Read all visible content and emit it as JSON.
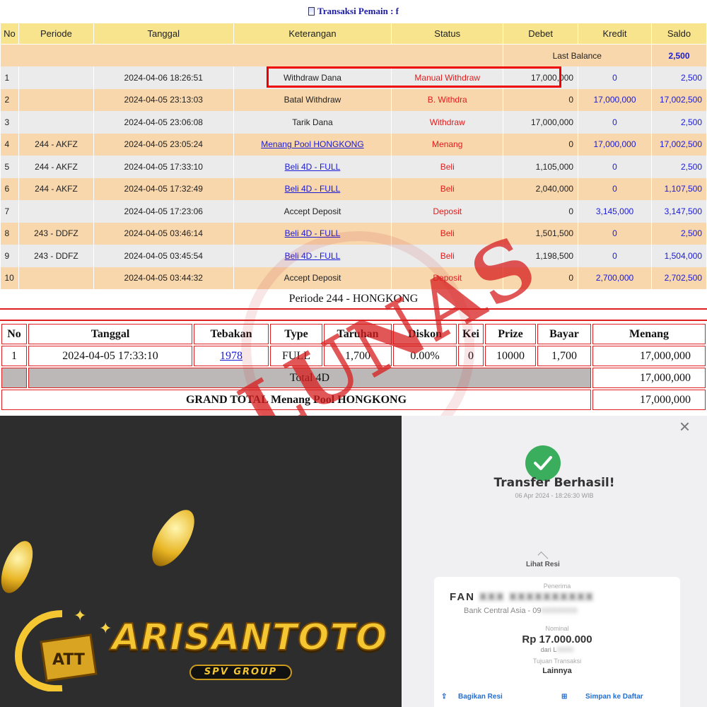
{
  "header": {
    "title": "Transaksi Pemain : f"
  },
  "tx_table": {
    "columns": [
      "No",
      "Periode",
      "Tanggal",
      "Keterangan",
      "Status",
      "Debet",
      "Kredit",
      "Saldo"
    ],
    "last_balance_label": "Last Balance",
    "last_balance_value": "2,500",
    "rows": [
      {
        "no": "1",
        "periode": "",
        "tanggal": "2024-04-06 18:26:51",
        "keterangan": "Withdraw Dana",
        "link": false,
        "status": "Manual Withdraw",
        "debet": "17,000,000",
        "kredit": "0",
        "saldo": "2,500"
      },
      {
        "no": "2",
        "periode": "",
        "tanggal": "2024-04-05 23:13:03",
        "keterangan": "Batal Withdraw",
        "link": false,
        "status": "B. Withdra",
        "debet": "0",
        "kredit": "17,000,000",
        "saldo": "17,002,500"
      },
      {
        "no": "3",
        "periode": "",
        "tanggal": "2024-04-05 23:06:08",
        "keterangan": "Tarik Dana",
        "link": false,
        "status": "Withdraw",
        "debet": "17,000,000",
        "kredit": "0",
        "saldo": "2,500"
      },
      {
        "no": "4",
        "periode": "244 - AKFZ",
        "tanggal": "2024-04-05 23:05:24",
        "keterangan": "Menang Pool HONGKONG",
        "link": true,
        "status": "Menang",
        "debet": "0",
        "kredit": "17,000,000",
        "saldo": "17,002,500"
      },
      {
        "no": "5",
        "periode": "244 - AKFZ",
        "tanggal": "2024-04-05 17:33:10",
        "keterangan": "Beli 4D - FULL",
        "link": true,
        "status": "Beli",
        "debet": "1,105,000",
        "kredit": "0",
        "saldo": "2,500"
      },
      {
        "no": "6",
        "periode": "244 - AKFZ",
        "tanggal": "2024-04-05 17:32:49",
        "keterangan": "Beli 4D - FULL",
        "link": true,
        "status": "Beli",
        "debet": "2,040,000",
        "kredit": "0",
        "saldo": "1,107,500"
      },
      {
        "no": "7",
        "periode": "",
        "tanggal": "2024-04-05 17:23:06",
        "keterangan": "Accept Deposit",
        "link": false,
        "status": "Deposit",
        "debet": "0",
        "kredit": "3,145,000",
        "saldo": "3,147,500"
      },
      {
        "no": "8",
        "periode": "243 - DDFZ",
        "tanggal": "2024-04-05 03:46:14",
        "keterangan": "Beli 4D - FULL",
        "link": true,
        "status": "Beli",
        "debet": "1,501,500",
        "kredit": "0",
        "saldo": "2,500"
      },
      {
        "no": "9",
        "periode": "243 - DDFZ",
        "tanggal": "2024-04-05 03:45:54",
        "keterangan": "Beli 4D - FULL",
        "link": true,
        "status": "Beli",
        "debet": "1,198,500",
        "kredit": "0",
        "saldo": "1,504,000"
      },
      {
        "no": "10",
        "periode": "",
        "tanggal": "2024-04-05 03:44:32",
        "keterangan": "Accept Deposit",
        "link": false,
        "status": "Deposit",
        "debet": "0",
        "kredit": "2,700,000",
        "saldo": "2,702,500"
      }
    ]
  },
  "periode": {
    "title": "Periode 244 - HONGKONG",
    "columns": [
      "No",
      "Tanggal",
      "Tebakan",
      "Type",
      "Taruhan",
      "Diskon",
      "Kei",
      "Prize",
      "Bayar",
      "Menang"
    ],
    "row": {
      "no": "1",
      "tanggal": "2024-04-05 17:33:10",
      "tebakan": "1978",
      "type": "FULL",
      "taruhan": "1,700",
      "diskon": "0.00%",
      "kei": "0",
      "prize": "10000",
      "bayar": "1,700",
      "menang": "17,000,000"
    },
    "total_label": "Total 4D",
    "total_value": "17,000,000",
    "grand_label": "GRAND TOTAL  Menang Pool HONGKONG",
    "grand_value": "17,000,000"
  },
  "stamp": {
    "text": "LUNAS"
  },
  "brand": {
    "name": "ARISANTOTO",
    "sub": "SPV GROUP"
  },
  "receipt": {
    "close": "×",
    "title": "Transfer Berhasil!",
    "time": "06 Apr 2024 - 18:26:30 WIB",
    "lihat": "Lihat Resi",
    "penerima_label": "Penerima",
    "penerima_name": "FAN",
    "penerima_bank": "Bank Central Asia - 09",
    "nominal_label": "Nominal",
    "nominal": "Rp 17.000.000",
    "nominal_from": "dari L",
    "tujuan_label": "Tujuan Transaksi",
    "tujuan": "Lainnya",
    "share": "Bagikan Resi",
    "save": "Simpan ke Daftar"
  },
  "colors": {
    "header_bg": "#f7e48c",
    "row_odd": "#ebebeb",
    "row_even": "#f8d7ad",
    "status_red": "#e31b1b",
    "link_blue": "#1a1ad6",
    "success_green": "#3aae5c"
  }
}
